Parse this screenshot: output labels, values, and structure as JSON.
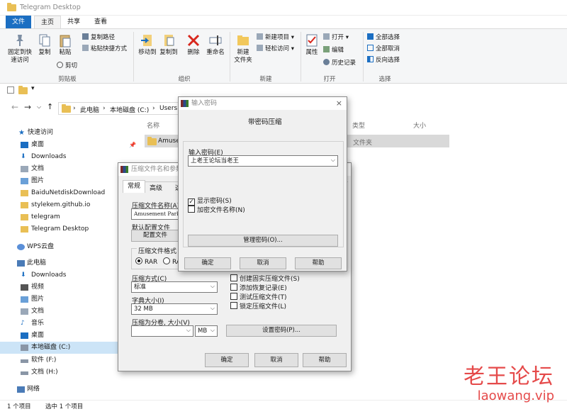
{
  "window": {
    "title": "Telegram Desktop"
  },
  "ribbon_tabs": [
    "文件",
    "主页",
    "共享",
    "查看"
  ],
  "ribbon": {
    "clipboard": {
      "pin": "固定到快\n速访问",
      "copy": "复制",
      "paste": "粘贴",
      "copy_path": "复制路径",
      "paste_shortcut": "粘贴快捷方式",
      "cut": "剪切",
      "group": "剪贴板"
    },
    "organize": {
      "move_to": "移动到",
      "copy_to": "复制到",
      "delete": "删除",
      "rename": "重命名",
      "group": "组织"
    },
    "new": {
      "new_folder": "新建\n文件夹",
      "new_item": "新建项目",
      "easy_access": "轻松访问",
      "group": "新建"
    },
    "open": {
      "properties": "属性",
      "open": "打开",
      "edit": "编辑",
      "history": "历史记录",
      "group": "打开"
    },
    "select": {
      "select_all": "全部选择",
      "select_none": "全部取消",
      "invert": "反向选择",
      "group": "选择"
    }
  },
  "address": {
    "crumbs": [
      "此电脑",
      "本地磁盘 (C:)",
      "Users"
    ]
  },
  "nav": [
    {
      "label": "快速访问"
    },
    {
      "label": "桌面"
    },
    {
      "label": "Downloads"
    },
    {
      "label": "文档"
    },
    {
      "label": "图片"
    },
    {
      "label": "BaiduNetdiskDownload"
    },
    {
      "label": "stylekem.github.io"
    },
    {
      "label": "telegram"
    },
    {
      "label": "Telegram Desktop"
    },
    {
      "label": "WPS云盘"
    },
    {
      "label": "此电脑"
    },
    {
      "label": "Downloads"
    },
    {
      "label": "视频"
    },
    {
      "label": "图片"
    },
    {
      "label": "文档"
    },
    {
      "label": "音乐"
    },
    {
      "label": "桌面"
    },
    {
      "label": "本地磁盘 (C:)"
    },
    {
      "label": "软件 (F:)"
    },
    {
      "label": "文档 (H:)"
    },
    {
      "label": "网络"
    }
  ],
  "columns": {
    "name": "名称",
    "type": "类型",
    "size": "大小"
  },
  "file_row": {
    "name": "Amuse",
    "type": "文件夹"
  },
  "status": {
    "count": "1 个项目",
    "selected": "选中 1 个项目"
  },
  "archive_dialog": {
    "title": "压缩文件名和参数",
    "tabs": [
      "常规",
      "高级",
      "选"
    ],
    "archive_name_label": "压缩文件名称(A)",
    "archive_name_value": "Amusement Park",
    "default_profile_label": "默认配置文件",
    "profile_button": "配置文件",
    "format_label": "压缩文件格式",
    "format_rar": "RAR",
    "format_rar4": "RAR",
    "method_label": "压缩方式(C)",
    "method_value": "标准",
    "dict_label": "字典大小(I)",
    "dict_value": "32 MB",
    "split_label": "压缩为分卷, 大小(V)",
    "split_unit": "MB",
    "options": [
      "创建固实压缩文件(S)",
      "添加恢复记录(E)",
      "测试压缩文件(T)",
      "锁定压缩文件(L)"
    ],
    "set_password": "设置密码(P)...",
    "ok": "确定",
    "cancel": "取消",
    "help": "帮助"
  },
  "password_dialog": {
    "title": "输入密码",
    "heading": "带密码压缩",
    "input_label": "输入密码(E)",
    "password_value": "上老王论坛当老王",
    "show_password": "显示密码(S)",
    "encrypt_names": "加密文件名称(N)",
    "manage": "管理密码(O)...",
    "ok": "确定",
    "cancel": "取消",
    "help": "帮助"
  },
  "watermark": {
    "cn": "老王论坛",
    "en": "laowang.vip"
  }
}
